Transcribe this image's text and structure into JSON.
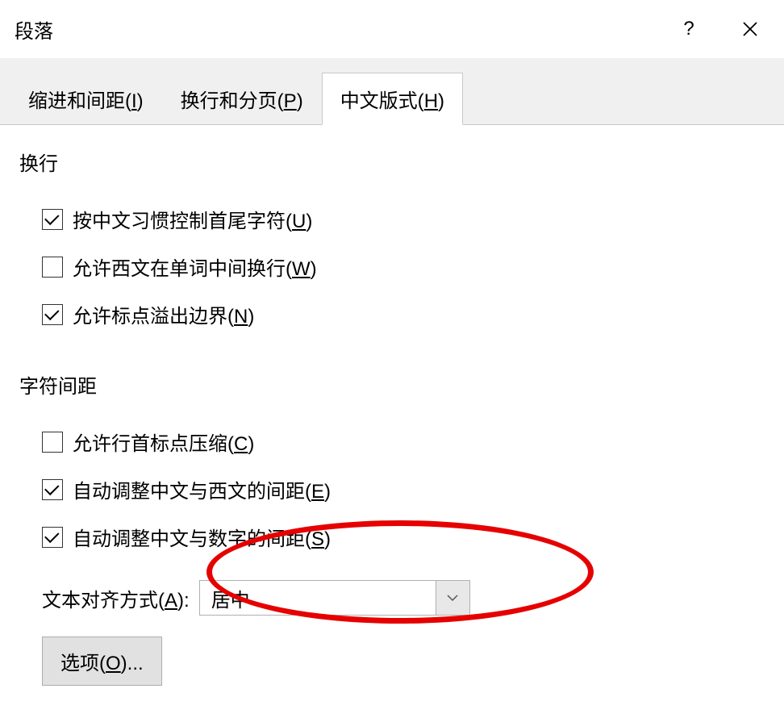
{
  "dialog": {
    "title": "段落",
    "help_label": "?"
  },
  "tabs": [
    {
      "label_pre": "缩进和间距(",
      "mnemonic": "I",
      "label_post": ")"
    },
    {
      "label_pre": "换行和分页(",
      "mnemonic": "P",
      "label_post": ")"
    },
    {
      "label_pre": "中文版式(",
      "mnemonic": "H",
      "label_post": ")"
    }
  ],
  "sections": {
    "line_break": {
      "title": "换行",
      "items": [
        {
          "checked": true,
          "label_pre": "按中文习惯控制首尾字符(",
          "mnemonic": "U",
          "label_post": ")"
        },
        {
          "checked": false,
          "label_pre": "允许西文在单词中间换行(",
          "mnemonic": "W",
          "label_post": ")"
        },
        {
          "checked": true,
          "label_pre": "允许标点溢出边界(",
          "mnemonic": "N",
          "label_post": ")"
        }
      ]
    },
    "char_spacing": {
      "title": "字符间距",
      "items": [
        {
          "checked": false,
          "label_pre": "允许行首标点压缩(",
          "mnemonic": "C",
          "label_post": ")"
        },
        {
          "checked": true,
          "label_pre": "自动调整中文与西文的间距(",
          "mnemonic": "E",
          "label_post": ")"
        },
        {
          "checked": true,
          "label_pre": "自动调整中文与数字的间距(",
          "mnemonic": "S",
          "label_post": ")"
        }
      ]
    }
  },
  "alignment": {
    "label_pre": "文本对齐方式(",
    "mnemonic": "A",
    "label_post": "):",
    "value": "居中"
  },
  "options_button": {
    "label_pre": "选项(",
    "mnemonic": "O",
    "label_post": ")..."
  },
  "highlight": {
    "color": "#e60000"
  }
}
